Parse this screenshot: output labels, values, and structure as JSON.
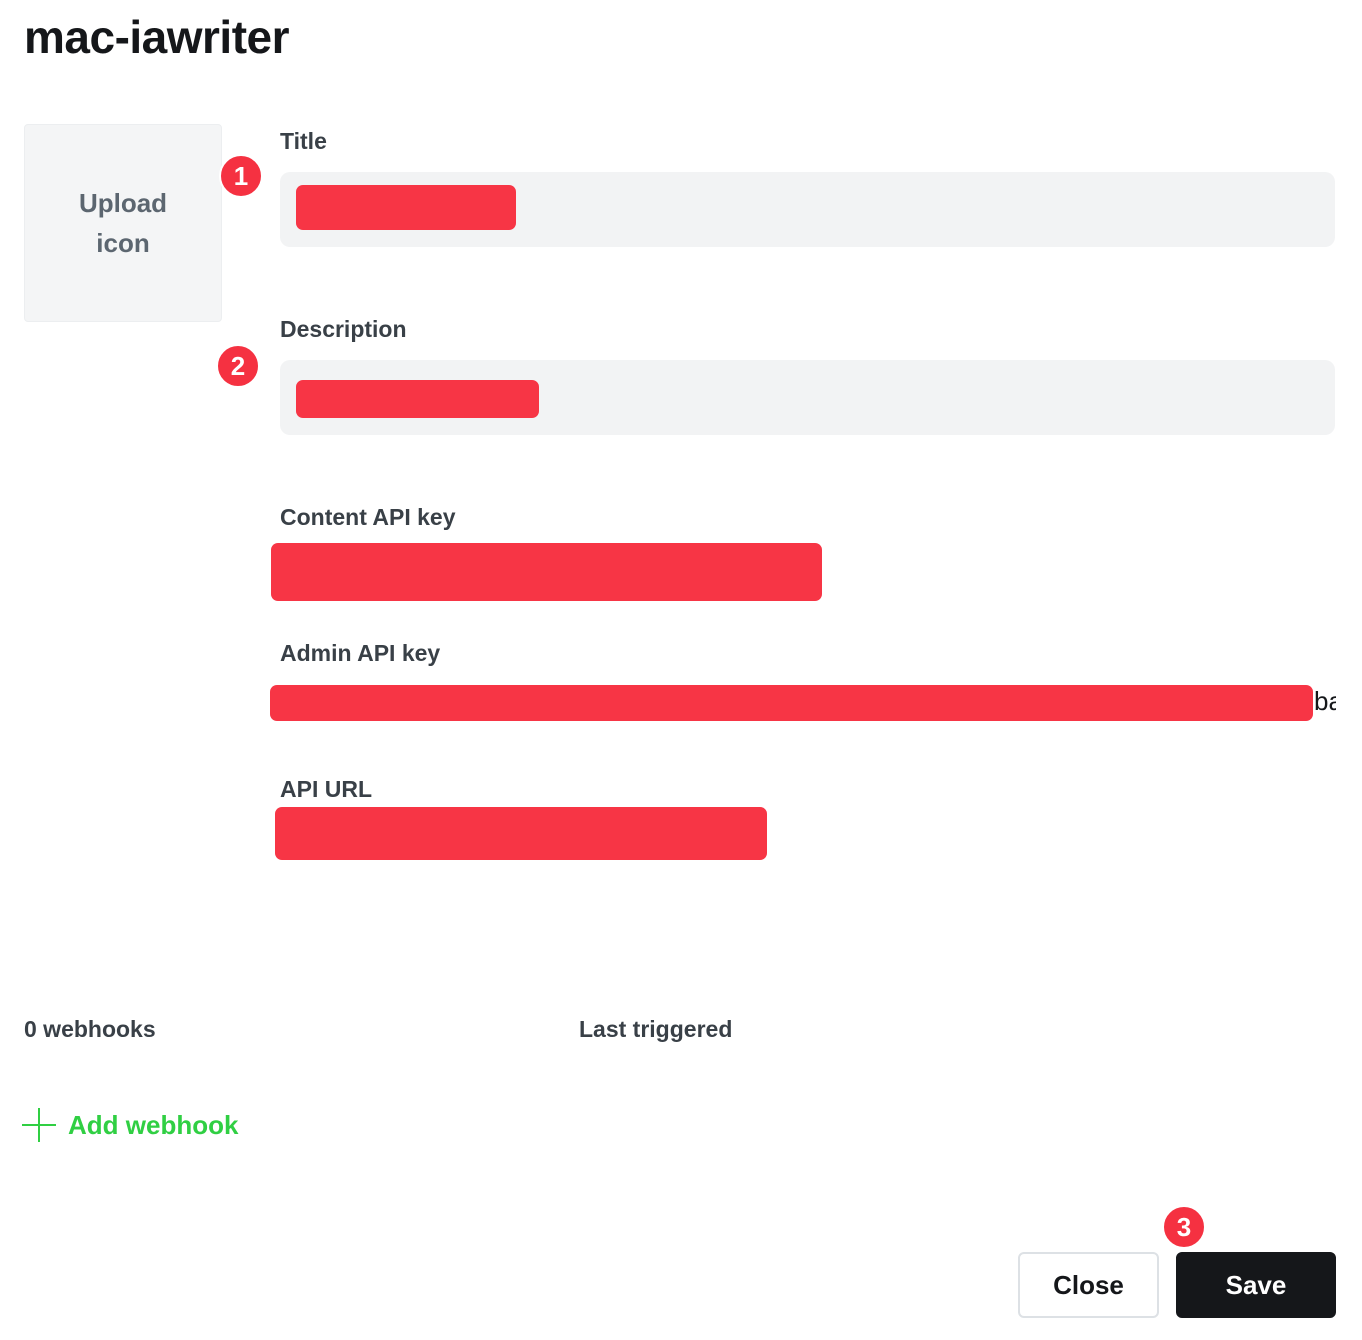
{
  "page": {
    "title": "mac-iawriter"
  },
  "icon_upload": {
    "label": "Upload icon"
  },
  "annotations": {
    "badge_1": "1",
    "badge_2": "2",
    "badge_3": "3"
  },
  "form": {
    "title_label": "Title",
    "description_label": "Description",
    "content_api_key_label": "Content API key",
    "admin_api_key_label": "Admin API key",
    "admin_api_key_visible_tail": "ba",
    "api_url_label": "API URL"
  },
  "webhooks": {
    "count_label": "0 webhooks",
    "last_triggered_label": "Last triggered",
    "add_label": "Add webhook"
  },
  "actions": {
    "close_label": "Close",
    "save_label": "Save"
  },
  "colors": {
    "redaction": "#f73545",
    "badge": "#f53141",
    "accent_green": "#30cf43",
    "primary_button": "#15171a"
  },
  "icons": {
    "add_webhook": "plus-icon"
  }
}
